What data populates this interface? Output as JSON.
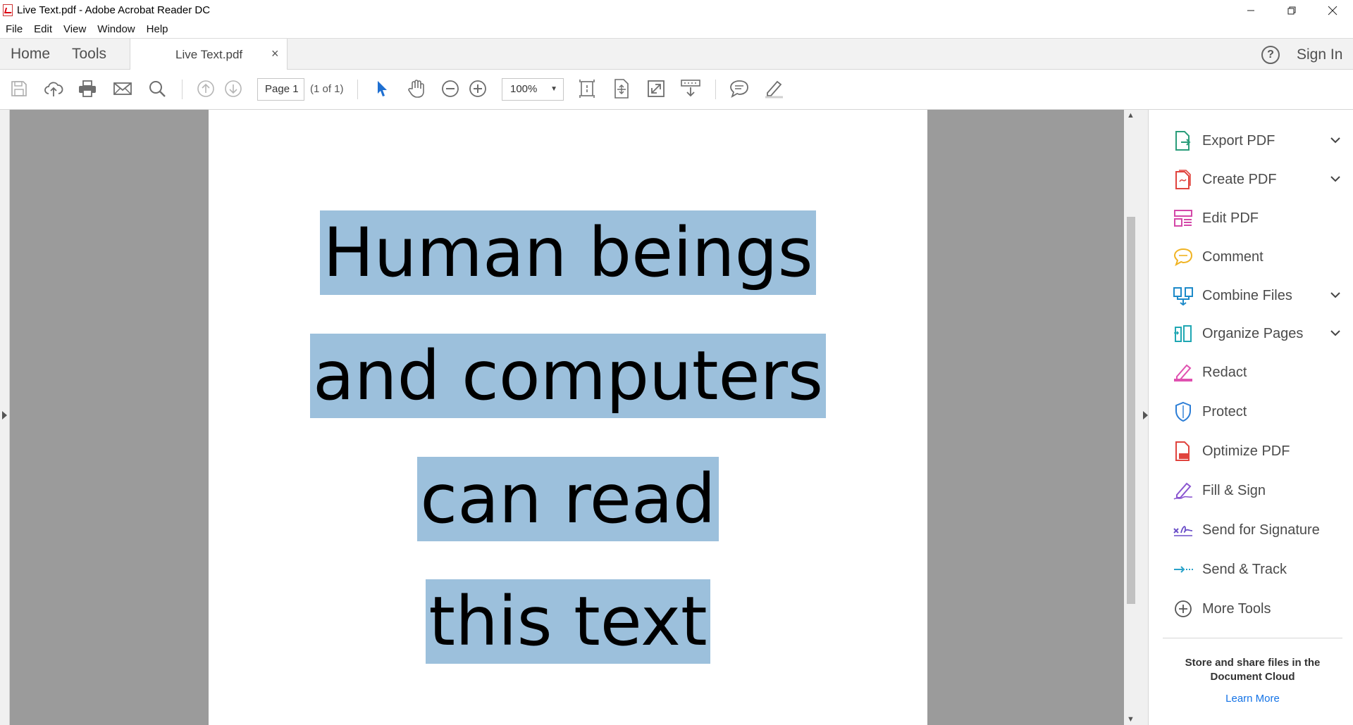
{
  "window": {
    "title": "Live Text.pdf - Adobe Acrobat Reader DC"
  },
  "menu": [
    "File",
    "Edit",
    "View",
    "Window",
    "Help"
  ],
  "tabs": {
    "home": "Home",
    "tools": "Tools",
    "document": "Live Text.pdf",
    "close": "×"
  },
  "header": {
    "help": "?",
    "sign_in": "Sign In"
  },
  "toolbar": {
    "page_field": "Page 1",
    "page_count": "(1 of 1)",
    "zoom": "100%"
  },
  "document": {
    "lines": [
      "Human beings",
      "and computers",
      "can read",
      "this text"
    ],
    "highlight_color": "#9cc0dc"
  },
  "tools_pane": {
    "items": [
      {
        "label": "Export PDF",
        "icon": "export-pdf-icon",
        "expandable": true
      },
      {
        "label": "Create PDF",
        "icon": "create-pdf-icon",
        "expandable": true
      },
      {
        "label": "Edit PDF",
        "icon": "edit-pdf-icon",
        "expandable": false
      },
      {
        "label": "Comment",
        "icon": "comment-icon",
        "expandable": false
      },
      {
        "label": "Combine Files",
        "icon": "combine-files-icon",
        "expandable": true
      },
      {
        "label": "Organize Pages",
        "icon": "organize-pages-icon",
        "expandable": true
      },
      {
        "label": "Redact",
        "icon": "redact-icon",
        "expandable": false
      },
      {
        "label": "Protect",
        "icon": "protect-icon",
        "expandable": false
      },
      {
        "label": "Optimize PDF",
        "icon": "optimize-pdf-icon",
        "expandable": false
      },
      {
        "label": "Fill & Sign",
        "icon": "fill-sign-icon",
        "expandable": false
      },
      {
        "label": "Send for Signature",
        "icon": "send-for-signature-icon",
        "expandable": false
      },
      {
        "label": "Send & Track",
        "icon": "send-track-icon",
        "expandable": false
      },
      {
        "label": "More Tools",
        "icon": "more-tools-icon",
        "expandable": false
      }
    ],
    "cloud_text": "Store and share files in the Document Cloud",
    "learn_more": "Learn More"
  }
}
